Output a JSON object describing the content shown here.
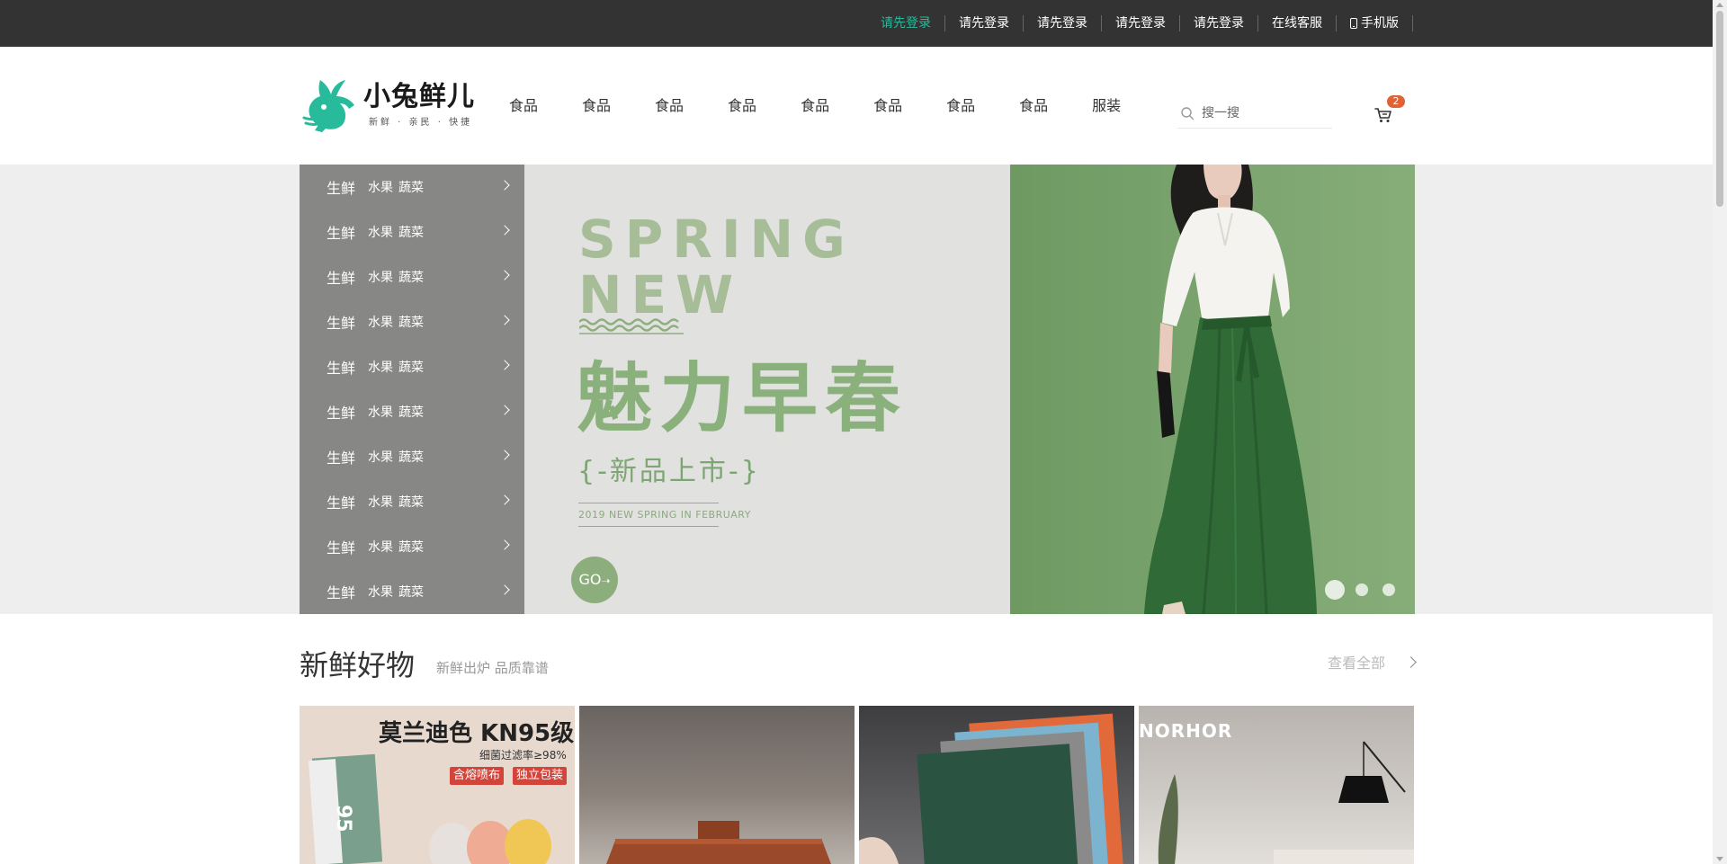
{
  "topbar": {
    "links": [
      {
        "label": "请先登录",
        "active": true
      },
      {
        "label": "请先登录",
        "active": false
      },
      {
        "label": "请先登录",
        "active": false
      },
      {
        "label": "请先登录",
        "active": false
      },
      {
        "label": "请先登录",
        "active": false
      },
      {
        "label": "在线客服",
        "active": false
      },
      {
        "label": "手机版",
        "active": false,
        "icon": "phone-icon"
      }
    ]
  },
  "header": {
    "logo": {
      "title": "小兔鲜儿",
      "slogan": "新鲜 · 亲民 · 快捷"
    },
    "nav": [
      "食品",
      "食品",
      "食品",
      "食品",
      "食品",
      "食品",
      "食品",
      "食品",
      "服装"
    ],
    "search": {
      "placeholder": "搜一搜"
    },
    "cart": {
      "count": "2",
      "icon": "cart-icon"
    }
  },
  "banner": {
    "categories": [
      {
        "main": "生鲜",
        "subs": [
          "水果",
          "蔬菜"
        ]
      },
      {
        "main": "生鲜",
        "subs": [
          "水果",
          "蔬菜"
        ]
      },
      {
        "main": "生鲜",
        "subs": [
          "水果",
          "蔬菜"
        ]
      },
      {
        "main": "生鲜",
        "subs": [
          "水果",
          "蔬菜"
        ]
      },
      {
        "main": "生鲜",
        "subs": [
          "水果",
          "蔬菜"
        ]
      },
      {
        "main": "生鲜",
        "subs": [
          "水果",
          "蔬菜"
        ]
      },
      {
        "main": "生鲜",
        "subs": [
          "水果",
          "蔬菜"
        ]
      },
      {
        "main": "生鲜",
        "subs": [
          "水果",
          "蔬菜"
        ]
      },
      {
        "main": "生鲜",
        "subs": [
          "水果",
          "蔬菜"
        ]
      },
      {
        "main": "生鲜",
        "subs": [
          "水果",
          "蔬菜"
        ]
      }
    ],
    "slide": {
      "en_title_1": "SPRING",
      "en_title_2": "NEW",
      "cn_title": "魅力早春",
      "cn_sub": "{-新品上市-}",
      "en_sub": "2019 NEW SPRING IN FEBRUARY",
      "go": "GO"
    },
    "dots": 3,
    "active_dot": 0
  },
  "section": {
    "title": "新鲜好物",
    "subtitle": "新鲜出炉 品质靠谱",
    "view_all": "查看全部"
  },
  "products": [
    {
      "title": "莫兰迪色 KN95级",
      "line2": "细菌过滤率≥98%",
      "tags": [
        "含熔喷布",
        "独立包装"
      ],
      "badge": "95"
    },
    {},
    {},
    {
      "brand": "NORHOR"
    }
  ],
  "colors": {
    "topbar_bg": "#333333",
    "brand_green": "#27ba9b",
    "badge_red": "#e26237"
  }
}
